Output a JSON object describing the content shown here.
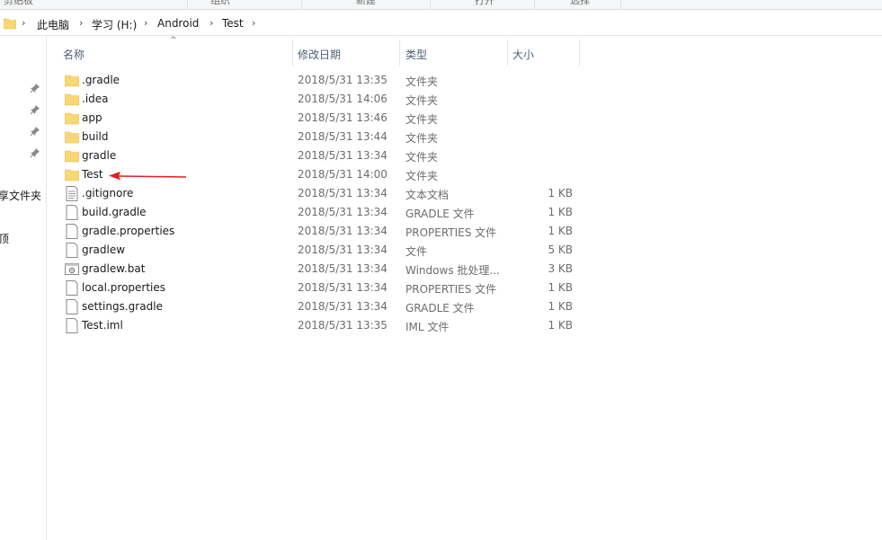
{
  "ribbon": {
    "groups": [
      "剪贴板",
      "组织",
      "新建",
      "打开",
      "选择"
    ]
  },
  "address": {
    "crumbs": [
      "此电脑",
      "学习 (H:)",
      "Android",
      "Test"
    ]
  },
  "nav": {
    "items": [
      "享文件夹",
      "顶"
    ]
  },
  "columns": {
    "name": "名称",
    "date": "修改日期",
    "type": "类型",
    "size": "大小"
  },
  "files": [
    {
      "name": ".gradle",
      "date": "2018/5/31 13:35",
      "type": "文件夹",
      "size": "",
      "icon": "folder-icon"
    },
    {
      "name": ".idea",
      "date": "2018/5/31 14:06",
      "type": "文件夹",
      "size": "",
      "icon": "folder-icon"
    },
    {
      "name": "app",
      "date": "2018/5/31 13:46",
      "type": "文件夹",
      "size": "",
      "icon": "folder-icon"
    },
    {
      "name": "build",
      "date": "2018/5/31 13:44",
      "type": "文件夹",
      "size": "",
      "icon": "folder-icon"
    },
    {
      "name": "gradle",
      "date": "2018/5/31 13:34",
      "type": "文件夹",
      "size": "",
      "icon": "folder-icon"
    },
    {
      "name": "Test",
      "date": "2018/5/31 14:00",
      "type": "文件夹",
      "size": "",
      "icon": "folder-icon"
    },
    {
      "name": ".gitignore",
      "date": "2018/5/31 13:34",
      "type": "文本文档",
      "size": "1 KB",
      "icon": "text-file-icon"
    },
    {
      "name": "build.gradle",
      "date": "2018/5/31 13:34",
      "type": "GRADLE 文件",
      "size": "1 KB",
      "icon": "file-icon"
    },
    {
      "name": "gradle.properties",
      "date": "2018/5/31 13:34",
      "type": "PROPERTIES 文件",
      "size": "1 KB",
      "icon": "file-icon"
    },
    {
      "name": "gradlew",
      "date": "2018/5/31 13:34",
      "type": "文件",
      "size": "5 KB",
      "icon": "file-icon"
    },
    {
      "name": "gradlew.bat",
      "date": "2018/5/31 13:34",
      "type": "Windows 批处理...",
      "size": "3 KB",
      "icon": "batch-file-icon"
    },
    {
      "name": "local.properties",
      "date": "2018/5/31 13:34",
      "type": "PROPERTIES 文件",
      "size": "1 KB",
      "icon": "file-icon"
    },
    {
      "name": "settings.gradle",
      "date": "2018/5/31 13:34",
      "type": "GRADLE 文件",
      "size": "1 KB",
      "icon": "file-icon"
    },
    {
      "name": "Test.iml",
      "date": "2018/5/31 13:35",
      "type": "IML 文件",
      "size": "1 KB",
      "icon": "file-icon"
    }
  ],
  "colors": {
    "folder": "#f8d775",
    "folder_dark": "#e7b94b",
    "header_text": "#4c607a",
    "arrow": "#e02020"
  }
}
